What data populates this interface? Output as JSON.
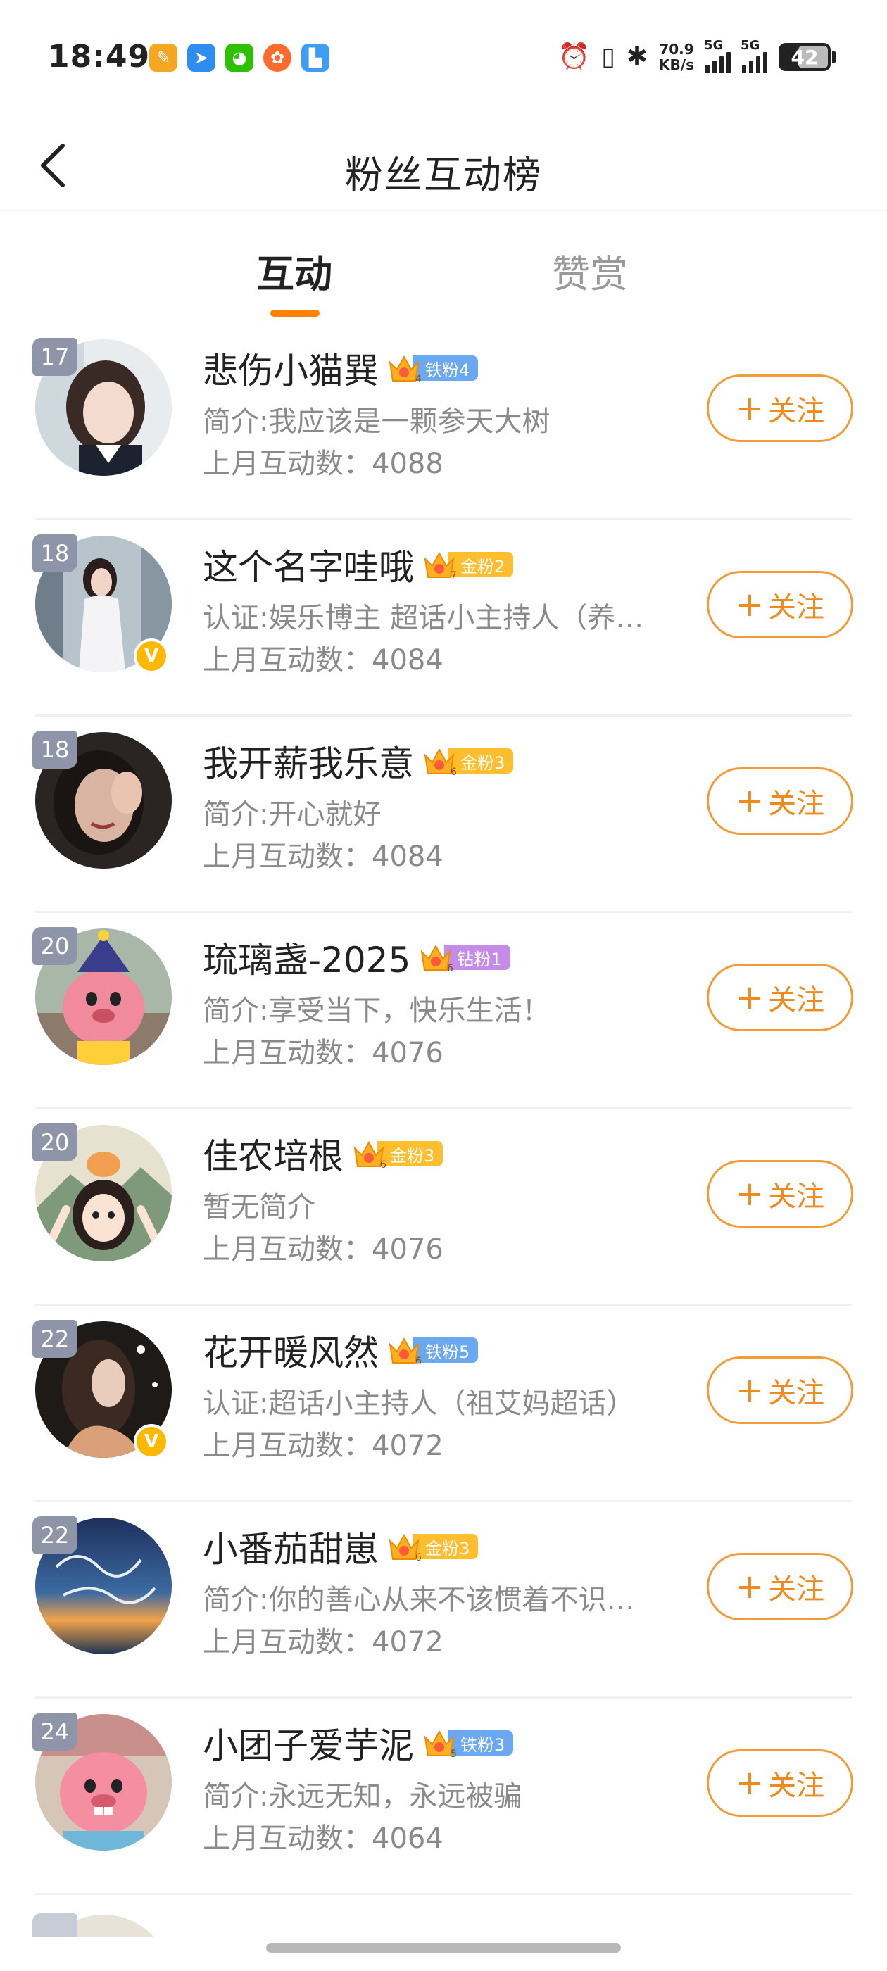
{
  "status_bar": {
    "time": "18:49",
    "net_speed_value": "70.9",
    "net_speed_unit": "KB/s",
    "net1_label": "5G",
    "net2_label": "5G",
    "battery": "42",
    "app_icons": [
      "app-icon-1",
      "app-icon-2",
      "wechat-icon",
      "app-icon-4",
      "app-icon-5"
    ],
    "alarm_icon": "alarm-icon",
    "vibrate_icon": "vibrate-icon",
    "bluetooth_icon": "bluetooth-icon"
  },
  "header": {
    "title": "粉丝互动榜",
    "back_icon": "back-arrow-icon"
  },
  "tabs": [
    {
      "label": "互动",
      "active": true
    },
    {
      "label": "赞赏",
      "active": false
    }
  ],
  "follow_label": "关注",
  "stat_prefix": "上月互动数：",
  "fans": [
    {
      "rank": "17",
      "name": "悲伤小猫巽",
      "crown_level": "4",
      "fan_level": "铁粉4",
      "intro": "简介:我应该是一颗参天大树",
      "count": "4088",
      "verified": false
    },
    {
      "rank": "18",
      "name": "这个名字哇哦",
      "crown_level": "7",
      "fan_level": "金粉2",
      "intro": "认证:娱乐博主 超话小主持人（养…",
      "count": "4084",
      "verified": true
    },
    {
      "rank": "18",
      "name": "我开薪我乐意",
      "crown_level": "6",
      "fan_level": "金粉3",
      "intro": "简介:开心就好",
      "count": "4084",
      "verified": false
    },
    {
      "rank": "20",
      "name": "琉璃盏-2025",
      "crown_level": "6",
      "fan_level": "钻粉1",
      "intro": "简介:享受当下，快乐生活！",
      "count": "4076",
      "verified": false
    },
    {
      "rank": "20",
      "name": "佳农培根",
      "crown_level": "6",
      "fan_level": "金粉3",
      "intro": "暂无简介",
      "count": "4076",
      "verified": false
    },
    {
      "rank": "22",
      "name": "花开暖风然",
      "crown_level": "6",
      "fan_level": "铁粉5",
      "intro": "认证:超话小主持人（祖艾妈超话）",
      "count": "4072",
      "verified": true
    },
    {
      "rank": "22",
      "name": "小番茄甜崽",
      "crown_level": "6",
      "fan_level": "金粉3",
      "intro": "简介:你的善心从来不该惯着不识…",
      "count": "4072",
      "verified": false
    },
    {
      "rank": "24",
      "name": "小团子爱芋泥",
      "crown_level": "5",
      "fan_level": "铁粉3",
      "intro": "简介:永远无知，永远被骗",
      "count": "4064",
      "verified": false
    }
  ],
  "colors": {
    "accent": "#ff8200",
    "follow": "#f08a1c",
    "iron_fan": "#6aa8f2",
    "gold_fan": "#ffbe2e",
    "diamond_fan": "#c48be8",
    "rank_badge": "#8f95a8",
    "verified": "#ffb800"
  }
}
